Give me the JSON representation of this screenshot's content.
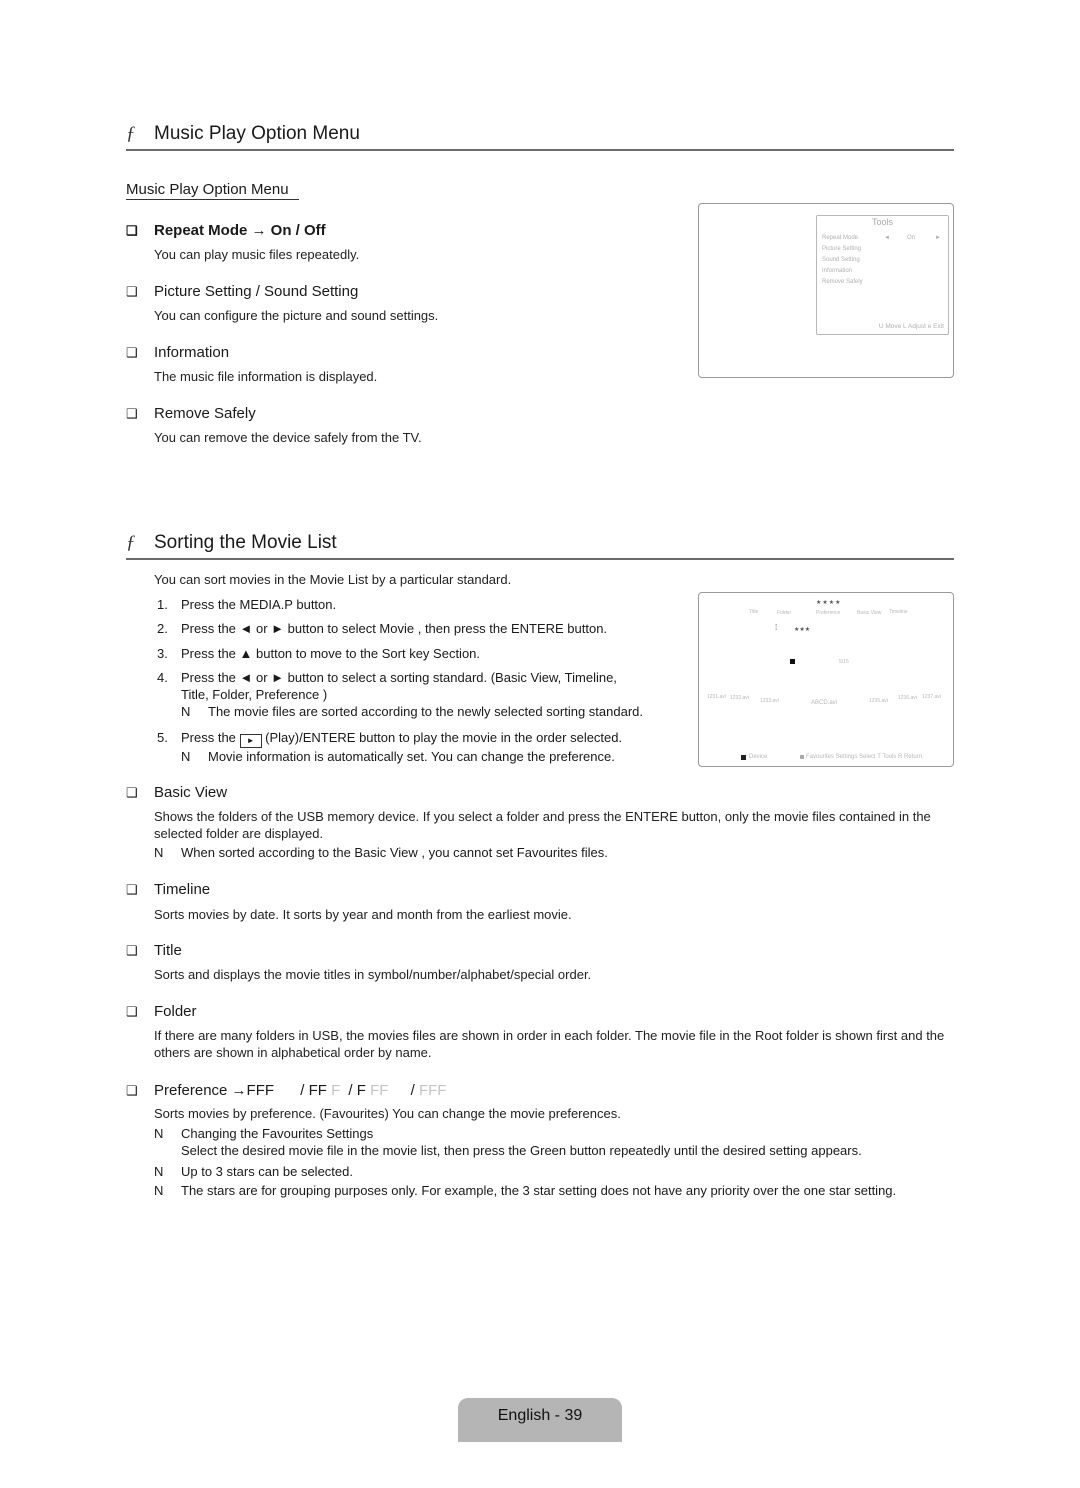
{
  "section1": {
    "title": "Music Play Option Menu",
    "bullet": "ƒ",
    "subtitle": "Music Play Option Menu",
    "items": [
      {
        "label": "Repeat Mode → On / Off",
        "desc": "You can play music files repeatedly."
      },
      {
        "label": "Picture Setting / Sound Setting",
        "desc": "You can configure the picture and sound settings."
      },
      {
        "label": "Information",
        "desc": "The music file information is displayed."
      },
      {
        "label": "Remove Safely",
        "desc": "You can remove the device safely from the TV."
      }
    ],
    "checkbox_glyph": "❑",
    "tools_screen": {
      "title": "Tools",
      "items": [
        "Repeat Mode",
        "Picture Setting",
        "Sound Setting",
        "Information",
        "Remove Safely"
      ],
      "repeat_value": "On",
      "left_arrow": "◄",
      "right_arrow": "►",
      "footer": "U Move   L Adjust   e Exit"
    }
  },
  "section2": {
    "title": "Sorting the Movie List",
    "bullet": "ƒ",
    "intro": "You can sort movies in the Movie List by a particular standard.",
    "steps": [
      {
        "num": "1.",
        "text": "Press the MEDIA.P button."
      },
      {
        "num": "2.",
        "text": "Press the ◄ or ► button to select Movie , then press the ENTERE    button."
      },
      {
        "num": "3.",
        "text": "Press the ▲ button to move to the Sort key Section."
      },
      {
        "num": "4.",
        "text": "Press the ◄ or ► button to select a sorting standard. (Basic View, Timeline,",
        "text2": "Title, Folder, Preference   )",
        "note": "The movie files are sorted according to the newly selected sorting standard."
      },
      {
        "num": "5.",
        "text_pre": "Press the",
        "play_glyph": "►",
        "text": "(Play)/ENTERE    button to play the movie in the order selected.",
        "note": "Movie information is automatically set. You can change the preference."
      }
    ],
    "note_glyph": "N",
    "movie_screen": {
      "stars_top": "★★★★",
      "sort_tabs": [
        "Title",
        "Folder",
        "Preference",
        "Basic View",
        "Timeline"
      ],
      "stars_item": "★★★",
      "counter": "5/15",
      "files": [
        "1231.avi",
        "1232.avi",
        "1233.avi",
        "ABCD.avi",
        "1235.avi",
        "1236.avi",
        "1237.avi"
      ],
      "footer_device": "Device",
      "footer_right": "Favourites Settings  Select  T Tools  R Return"
    },
    "items": [
      {
        "label": "Basic View",
        "desc": "Shows the folders of the USB memory device. If you select a folder and press the ENTERE    button, only the movie files contained in the selected folder are displayed.",
        "notes": [
          "When sorted according to the Basic View , you cannot set Favourites files."
        ]
      },
      {
        "label": "Timeline",
        "desc": "Sorts movies by date. It sorts by year and month from the earliest movie."
      },
      {
        "label": "Title",
        "desc": "Sorts and displays the movie titles in symbol/number/alphabet/special order."
      },
      {
        "label": "Folder",
        "desc": "If there are many folders in USB, the movies files are shown in order in each folder. The movie file in the Root folder is shown first and the others are shown in alphabetical order by name."
      },
      {
        "label": "Preference",
        "arrow": "→",
        "levels": [
          {
            "on": "FFF",
            "off": ""
          },
          {
            "on": "FF",
            "off": "F"
          },
          {
            "on": "F",
            "off": "FF"
          },
          {
            "on": "",
            "off": "FFF"
          }
        ],
        "desc": "Sorts movies by preference. (Favourites) You can change the movie preferences.",
        "notes": [
          {
            "text": "Changing the Favourites Settings",
            "sub": "Select the desired movie file in the movie list, then press the Green button repeatedly until the desired setting appears."
          },
          {
            "text": "Up to 3 stars can be selected."
          },
          {
            "text": "The stars are for grouping purposes only. For example, the 3 star setting does not have any priority over the one star setting."
          }
        ]
      }
    ]
  },
  "footer": {
    "page_label": "English - 39"
  }
}
